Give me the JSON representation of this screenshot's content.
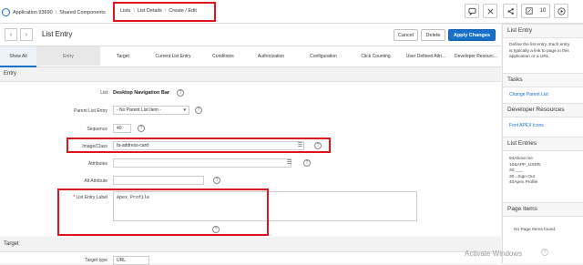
{
  "breadcrumb": {
    "app": "Application 93690",
    "shared": "Shared Components",
    "lists": "Lists",
    "list_details": "List Details",
    "create_edit": "Create / Edit"
  },
  "topbar": {
    "counter": "10"
  },
  "toolbar": {
    "title": "List Entry",
    "cancel": "Cancel",
    "delete": "Delete",
    "apply": "Apply Changes"
  },
  "tabs": [
    "Show All",
    "Entry",
    "Target",
    "Current List Entry",
    "Conditions",
    "Authorization",
    "Configuration",
    "Click Counting",
    "User Defined Attri...",
    "Developer Resourc..."
  ],
  "sections": {
    "entry": "Entry",
    "target": "Target"
  },
  "form": {
    "list_label": "List",
    "list_value": "Desktop Navigation Bar",
    "parent_label": "Parent List Entry",
    "parent_value": "- No Parent List Item -",
    "sequence_label": "Sequence",
    "sequence_value": "40",
    "image_label": "Image/Class",
    "image_value": "fa-address-card",
    "attributes_label": "Attributes",
    "alt_label": "Alt Attribute",
    "entry_label_label": "List Entry Label",
    "entry_label_value": "Apex Profile",
    "required_mark": "*",
    "target_type_label": "Target type",
    "target_type_value": "URL"
  },
  "right_panel": {
    "list_entry_h": "List Entry",
    "list_entry_desc": [
      "Define the list entry. Each entry",
      "is typically a link to page in this",
      "application or a URL."
    ],
    "tasks_h": "Tasks",
    "change_parent": "Change Parent List",
    "dev_res_h": "Developer Resources",
    "font_apex": "Font APEX Icons",
    "entries_h": "List Entries",
    "entries": [
      "94About me",
      "10&APP_USER.",
      "20.___",
      "30...Sign Out",
      "40Apex Profile"
    ],
    "page_items_h": "Page Items",
    "no_items": "No Page Items found."
  },
  "watermark": "Activate Windows"
}
